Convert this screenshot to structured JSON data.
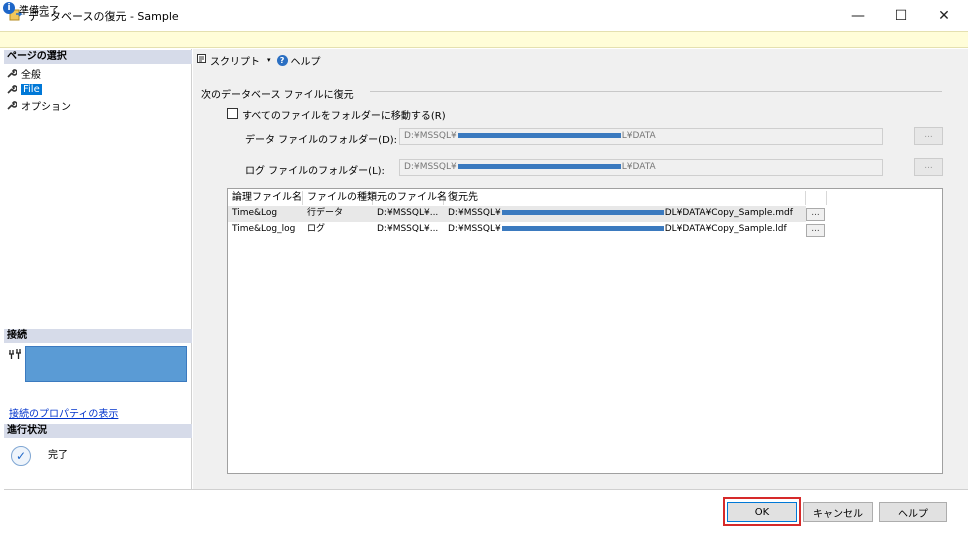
{
  "window": {
    "title": "データベースの復元 - Sample",
    "controls": {
      "minimize": "—",
      "maximize": "☐",
      "close": "✕"
    }
  },
  "status": {
    "text": "準備完了",
    "icon": "info-icon"
  },
  "left": {
    "page_select_header": "ページの選択",
    "nav": [
      {
        "label": "全般",
        "icon": "wrench-icon",
        "selected": false
      },
      {
        "label": "File",
        "icon": "wrench-icon",
        "selected": true
      },
      {
        "label": "オプション",
        "icon": "wrench-icon",
        "selected": false
      }
    ],
    "connection_header": "接続",
    "connection_link": "接続のプロパティの表示",
    "progress_header": "進行状況",
    "progress_text": "完了"
  },
  "toolbar": {
    "script_label": "スクリプト",
    "help_label": "ヘルプ"
  },
  "form": {
    "section_title": "次のデータベース ファイルに復元",
    "move_all_label": "すべてのファイルをフォルダーに移動する(R)",
    "data_folder_label": "データ ファイルのフォルダー(D):",
    "data_folder_value_start": "D:¥MSSQL¥",
    "data_folder_value_end": "L¥DATA",
    "log_folder_label": "ログ ファイルのフォルダー(L):",
    "log_folder_value_start": "D:¥MSSQL¥",
    "log_folder_value_end": "L¥DATA",
    "browse_label": "..."
  },
  "grid": {
    "columns": [
      "論理ファイル名",
      "ファイルの種類",
      "元のファイル名",
      "復元先"
    ],
    "rows": [
      {
        "logical": "Time&Log",
        "type": "行データ",
        "original": "D:¥MSSQL¥...",
        "dest_start": "D:¥MSSQL¥",
        "dest_end": "DL¥DATA¥Copy_Sample.mdf",
        "btn": "..."
      },
      {
        "logical": "Time&Log_log",
        "type": "ログ",
        "original": "D:¥MSSQL¥...",
        "dest_start": "D:¥MSSQL¥",
        "dest_end": "DL¥DATA¥Copy_Sample.ldf",
        "btn": "..."
      }
    ]
  },
  "footer": {
    "ok": "OK",
    "cancel": "キャンセル",
    "help": "ヘルプ"
  },
  "colors": {
    "highlight": "#d62a2a",
    "selection": "#0078d7",
    "redaction": "#3b7abf"
  }
}
